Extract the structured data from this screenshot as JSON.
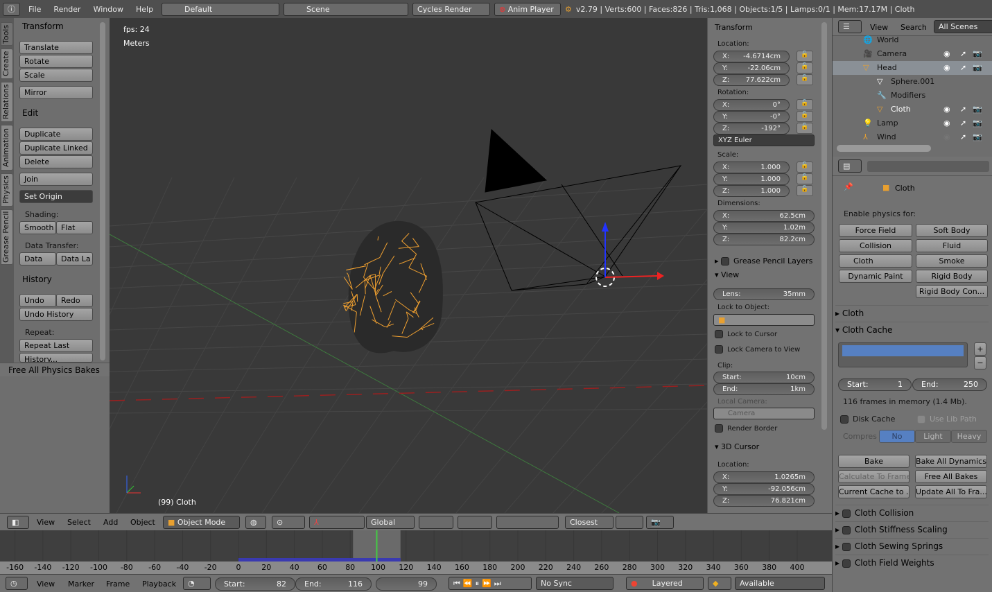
{
  "topbar": {
    "menus": [
      "File",
      "Render",
      "Window",
      "Help"
    ],
    "layout": "Default",
    "scene": "Scene",
    "engine": "Cycles Render",
    "anim_player": "Anim Player",
    "stats": "v2.79 | Verts:600 | Faces:826 | Tris:1,068 | Objects:1/5 | Lamps:0/1 | Mem:17.17M | Cloth"
  },
  "toolshelf": {
    "tabs": [
      "Tools",
      "Create",
      "Relations",
      "Animation",
      "Physics",
      "Grease Pencil"
    ],
    "transform": {
      "title": "Transform",
      "buttons": [
        "Translate",
        "Rotate",
        "Scale",
        "Mirror"
      ]
    },
    "edit": {
      "title": "Edit",
      "buttons": [
        "Duplicate",
        "Duplicate Linked",
        "Delete",
        "Join"
      ],
      "set_origin": "Set Origin",
      "shading_label": "Shading:",
      "smooth": "Smooth",
      "flat": "Flat",
      "data_transfer_label": "Data Transfer:",
      "data": "Data",
      "data_la": "Data La"
    },
    "history": {
      "title": "History",
      "undo": "Undo",
      "redo": "Redo",
      "undo_history": "Undo History",
      "repeat_label": "Repeat:",
      "repeat_last": "Repeat Last",
      "history": "History..."
    },
    "operator": "Free All Physics Bakes"
  },
  "viewport": {
    "fps": "fps: 24",
    "units": "Meters",
    "object_label": "(99) Cloth",
    "colors": {
      "wire": "#f0a030",
      "bg": "#393939"
    }
  },
  "npanel": {
    "transform": "Transform",
    "location_label": "Location:",
    "location": [
      [
        "X:",
        "-4.6714cm"
      ],
      [
        "Y:",
        "-22.06cm"
      ],
      [
        "Z:",
        "77.622cm"
      ]
    ],
    "rotation_label": "Rotation:",
    "rotation": [
      [
        "X:",
        "0°"
      ],
      [
        "Y:",
        "-0°"
      ],
      [
        "Z:",
        "-192°"
      ]
    ],
    "rotation_mode": "XYZ Euler",
    "scale_label": "Scale:",
    "scale": [
      [
        "X:",
        "1.000"
      ],
      [
        "Y:",
        "1.000"
      ],
      [
        "Z:",
        "1.000"
      ]
    ],
    "dimensions_label": "Dimensions:",
    "dimensions": [
      [
        "X:",
        "62.5cm"
      ],
      [
        "Y:",
        "1.02m"
      ],
      [
        "Z:",
        "82.2cm"
      ]
    ],
    "grease_pencil": "Grease Pencil Layers",
    "view": "View",
    "lens_label": "Lens:",
    "lens": "35mm",
    "lock_object_label": "Lock to Object:",
    "lock_cursor": "Lock to Cursor",
    "lock_camera": "Lock Camera to View",
    "clip_label": "Clip:",
    "clip": [
      [
        "Start:",
        "10cm"
      ],
      [
        "End:",
        "1km"
      ]
    ],
    "local_camera_label": "Local Camera:",
    "local_camera": "Camera",
    "render_border": "Render Border",
    "cursor": "3D Cursor",
    "cursor_location_label": "Location:",
    "cursor_location": [
      [
        "X:",
        "1.0265m"
      ],
      [
        "Y:",
        "-92.056cm"
      ],
      [
        "Z:",
        "76.821cm"
      ]
    ]
  },
  "outliner": {
    "view": "View",
    "search": "Search",
    "filter": "All Scenes",
    "items": [
      {
        "label": "World",
        "indent": 1
      },
      {
        "label": "Camera",
        "indent": 1
      },
      {
        "label": "Head",
        "indent": 1
      },
      {
        "label": "Sphere.001",
        "indent": 2
      },
      {
        "label": "Modifiers",
        "indent": 2
      },
      {
        "label": "Cloth",
        "indent": 2
      },
      {
        "label": "Lamp",
        "indent": 1
      },
      {
        "label": "Wind",
        "indent": 1
      }
    ]
  },
  "properties": {
    "context": "Cloth",
    "enable_label": "Enable physics for:",
    "physics": [
      [
        "Force Field",
        "Soft Body"
      ],
      [
        "Collision",
        "Fluid"
      ],
      [
        "Cloth",
        "Smoke"
      ],
      [
        "Dynamic Paint",
        "Rigid Body"
      ],
      [
        "",
        "Rigid Body Con..."
      ]
    ],
    "cloth": "Cloth",
    "cloth_cache": "Cloth Cache",
    "start_label": "Start:",
    "start": "1",
    "end_label": "End:",
    "end": "250",
    "memory": "116 frames in memory (1.4 Mb).",
    "disk_cache": "Disk Cache",
    "use_lib_path": "Use Lib Path",
    "compress_label": "Compres",
    "compress": [
      "No",
      "Light",
      "Heavy"
    ],
    "bake": "Bake",
    "bake_all": "Bake All Dynamics",
    "calc_frame": "Calculate To Frame",
    "free_all": "Free All Bakes",
    "current_cache": "Current Cache to ...",
    "update_all": "Update All To Fra...",
    "sections": [
      "Cloth Collision",
      "Cloth Stiffness Scaling",
      "Cloth Sewing Springs",
      "Cloth Field Weights"
    ],
    "accent": "#5680c2"
  },
  "view3d_header": {
    "menus": [
      "View",
      "Select",
      "Add",
      "Object"
    ],
    "mode": "Object Mode",
    "orientation": "Global",
    "snap": "Closest"
  },
  "timeline": {
    "ticks": [
      "-160",
      "-140",
      "-120",
      "-100",
      "-80",
      "-60",
      "-40",
      "-20",
      "0",
      "20",
      "40",
      "60",
      "80",
      "100",
      "120",
      "140",
      "160",
      "180",
      "200",
      "220",
      "240",
      "260",
      "280",
      "300",
      "320",
      "340",
      "360",
      "380",
      "400"
    ],
    "current_frame": 99,
    "cache_start": 82,
    "cache_end": 116
  },
  "timeline_header": {
    "menus": [
      "View",
      "Marker",
      "Frame",
      "Playback"
    ],
    "start_label": "Start:",
    "start": "82",
    "end_label": "End:",
    "end": "116",
    "frame": "99",
    "sync": "No Sync",
    "keying": "Layered",
    "keyset": "Available"
  }
}
